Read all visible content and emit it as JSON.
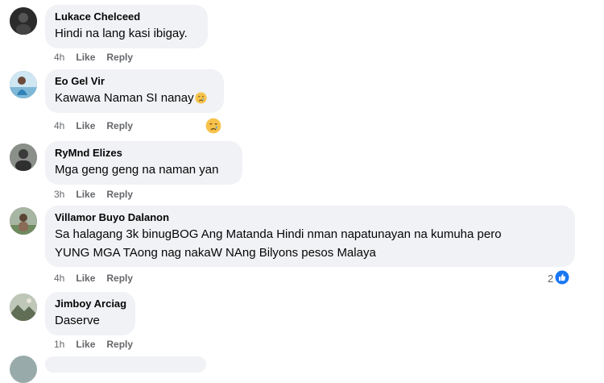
{
  "comments": [
    {
      "name": "Lukace Chelceed",
      "text": "Hindi na lang kasi ibigay.",
      "time": "4h",
      "like": "Like",
      "reply": "Reply",
      "avatar": "avatar-dark"
    },
    {
      "name": "Eo Gel Vir",
      "text": "Kawawa Naman SI nanay",
      "time": "4h",
      "like": "Like",
      "reply": "Reply",
      "avatar": "avatar-beach",
      "emoji": "crying-face-icon"
    },
    {
      "name": "RyMnd Elizes",
      "text": "Mga geng geng na naman yan",
      "time": "3h",
      "like": "Like",
      "reply": "Reply",
      "avatar": "avatar-portrait"
    },
    {
      "name": "Villamor Buyo Dalanon",
      "text_line1": "Sa halagang 3k binugBOG Ang Matanda Hindi nman napatunayan na kumuha pero",
      "text_line2": "YUNG MGA TAong nag nakaW NAng Bilyons pesos Malaya",
      "time": "4h",
      "like": "Like",
      "reply": "Reply",
      "avatar": "avatar-outdoor",
      "reaction_count": "2",
      "reaction_icon": "like-reaction-icon"
    },
    {
      "name": "Jimboy Arciag",
      "text": "Daserve",
      "time": "1h",
      "like": "Like",
      "reply": "Reply",
      "avatar": "avatar-landscape"
    }
  ],
  "colors": {
    "bubble": "#f0f2f5",
    "meta_text": "#65676b",
    "like_blue": "#1877f2"
  }
}
